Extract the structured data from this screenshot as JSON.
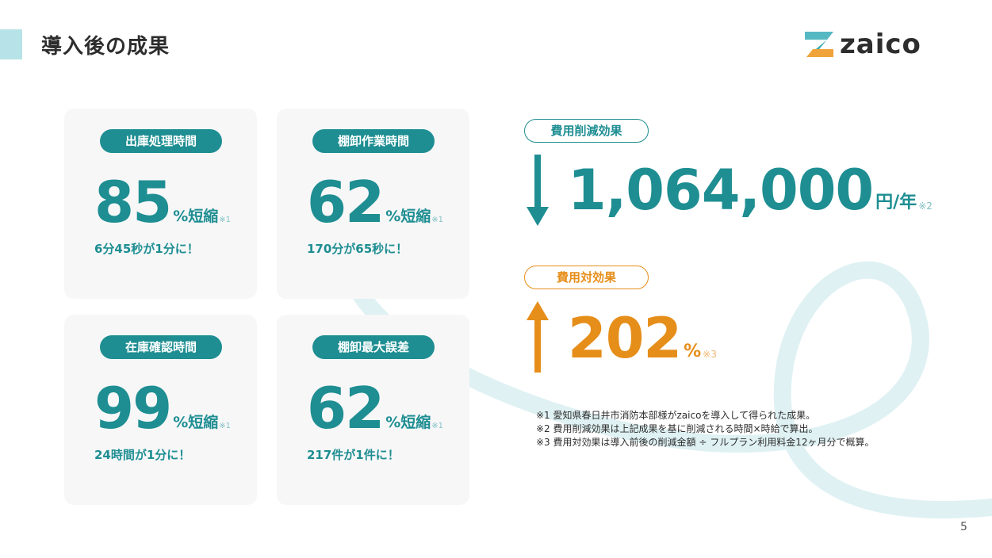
{
  "slide": {
    "title": "導入後の成果",
    "page_number": "5"
  },
  "logo": {
    "text": "zaico",
    "icon": "zaico-z-logo-icon"
  },
  "cards": [
    {
      "label": "出庫処理時間",
      "value": "85",
      "unit": "%短縮",
      "note": "※1",
      "detail": "6分45秒が1分に！"
    },
    {
      "label": "棚卸作業時間",
      "value": "62",
      "unit": "%短縮",
      "note": "※1",
      "detail": "170分が65秒に！"
    },
    {
      "label": "在庫確認時間",
      "value": "99",
      "unit": "%短縮",
      "note": "※1",
      "detail": "24時間が1分に！"
    },
    {
      "label": "棚卸最大誤差",
      "value": "62",
      "unit": "%短縮",
      "note": "※1",
      "detail": "217件が1件に！"
    }
  ],
  "cost_reduction": {
    "label": "費用削減効果",
    "value": "1,064,000",
    "unit": "円/年",
    "note": "※2",
    "icon": "arrow-down-icon"
  },
  "cost_effectiveness": {
    "label": "費用対効果",
    "value": "202",
    "unit": "%",
    "note": "※3",
    "icon": "arrow-up-icon"
  },
  "footnotes": [
    "※1 愛知県春日井市消防本部様がzaicoを導入して得られた成果。",
    "※2 費用削減効果は上記成果を基に削減される時間×時給で算出。",
    "※3 費用対効果は導入前後の削減金額 ÷ フルプラン利用料金12ヶ月分で概算。"
  ],
  "colors": {
    "teal": "#1e8e92",
    "orange": "#e68e1a",
    "accent_light": "#b7e3e8",
    "card_bg": "#f7f7f8"
  }
}
